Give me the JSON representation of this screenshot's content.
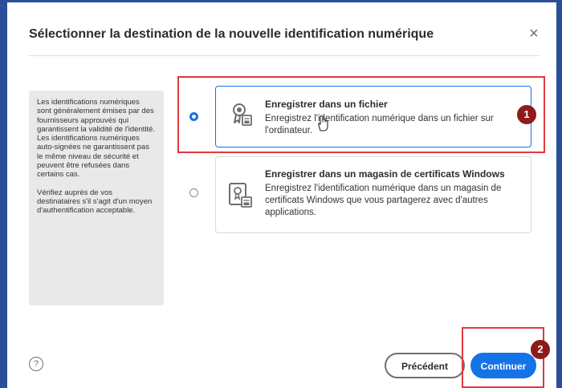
{
  "dialog": {
    "title": "Sélectionner la destination de la nouvelle identification numérique",
    "close_label": "×"
  },
  "info_panel": {
    "paragraphs": [
      "Les identifications numériques sont généralement émises par des fournisseurs approuvés qui garantissent la validité de l'identité.",
      "Les identifications numériques auto-signées ne garantissent pas le même niveau de sécurité et peuvent être refusées dans certains cas.",
      "Vérifiez auprès de vos destinataires s'il s'agit d'un moyen d'authentification acceptable."
    ]
  },
  "options": [
    {
      "title": "Enregistrer dans un fichier",
      "description": "Enregistrez l'identification numérique dans un fichier sur l'ordinateur.",
      "selected": true,
      "icon": "certificate-file-icon"
    },
    {
      "title": "Enregistrer dans un magasin de certificats Windows",
      "description": "Enregistrez l'identification numérique dans un magasin de certificats Windows que vous partagerez avec d'autres applications.",
      "selected": false,
      "icon": "certificate-store-icon"
    }
  ],
  "annotations": {
    "badge_1": "1",
    "badge_2": "2"
  },
  "footer": {
    "help_label": "?",
    "back_label": "Précédent",
    "continue_label": "Continuer"
  },
  "colors": {
    "accent": "#1473e6",
    "callout": "#e0393e",
    "badge": "#8e1a1a",
    "background": "#2a4f99"
  }
}
